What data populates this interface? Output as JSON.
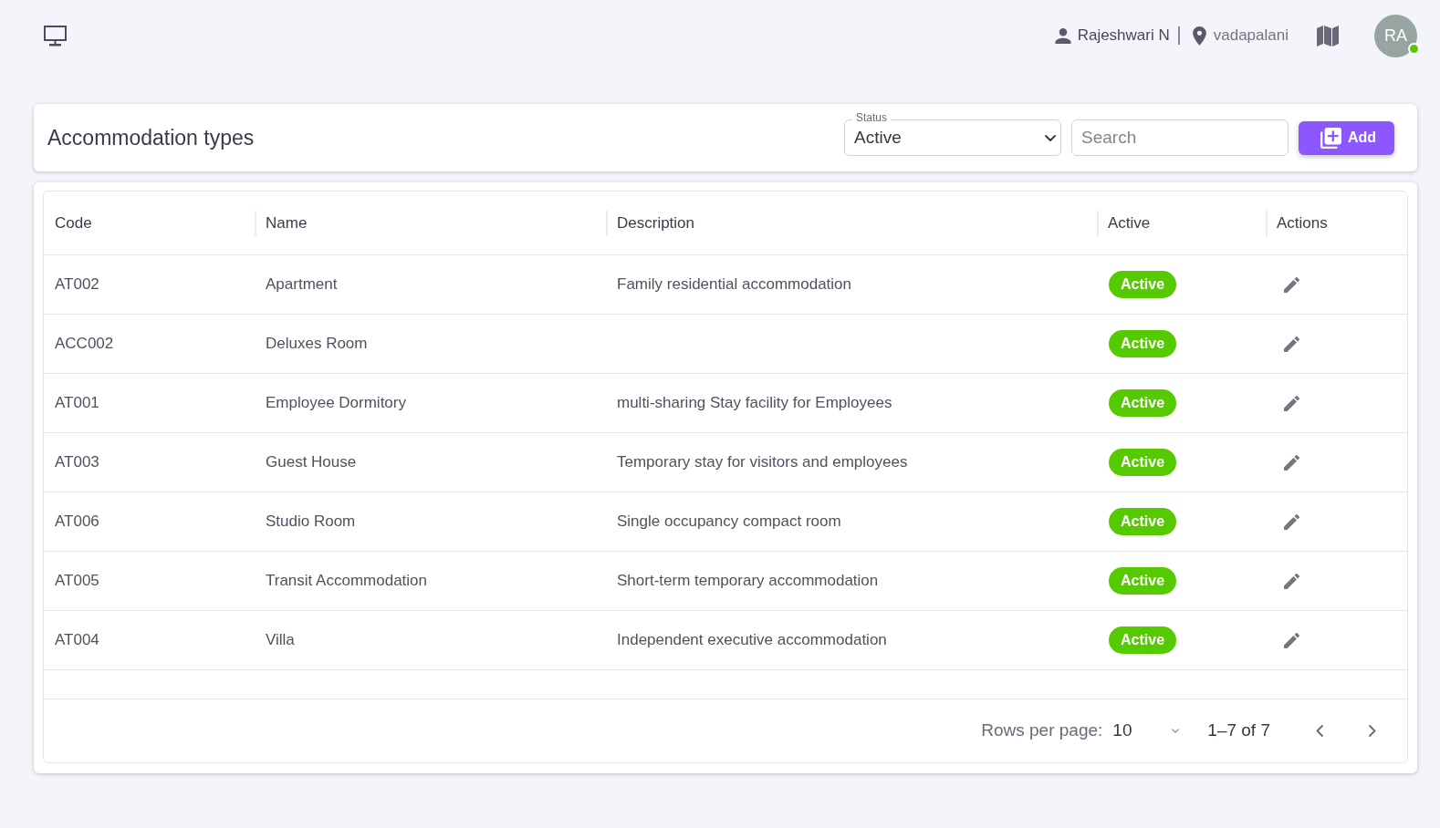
{
  "top_bar": {
    "user_name": "Rajeshwari N",
    "location": "vadapalani",
    "avatar": {
      "initials": "RA",
      "online": true
    }
  },
  "toolbar": {
    "title": "Accommodation types",
    "status_filter": {
      "label": "Status",
      "value": "Active"
    },
    "search": {
      "placeholder": "Search"
    },
    "add_button": "Add"
  },
  "table": {
    "columns": [
      "Code",
      "Name",
      "Description",
      "Active",
      "Actions"
    ],
    "rows": [
      {
        "code": "AT002",
        "name": "Apartment",
        "description": "Family residential accommodation",
        "status": "Active",
        "active": true
      },
      {
        "code": "ACC002",
        "name": "Deluxes Room",
        "status": "Active",
        "active": true
      },
      {
        "code": "AT001",
        "name": "Employee Dormitory",
        "description": "multi-sharing Stay facility for Employees",
        "status": "Active",
        "active": true
      },
      {
        "code": "AT003",
        "name": "Guest House",
        "description": "Temporary stay for visitors and employees",
        "status": "Active",
        "active": true
      },
      {
        "code": "AT006",
        "name": "Studio Room",
        "description": "Single occupancy compact room",
        "status": "Active",
        "active": true
      },
      {
        "code": "AT005",
        "name": "Transit Accommodation",
        "description": "Short-term temporary accommodation",
        "status": "Active",
        "active": true
      },
      {
        "code": "AT004",
        "name": "Villa",
        "description": "Independent executive accommodation",
        "status": "Active",
        "active": true
      }
    ]
  },
  "pagination": {
    "rows_per_page_label": "Rows per page:",
    "rows_per_page": "10",
    "range": "1–7 of 7"
  }
}
